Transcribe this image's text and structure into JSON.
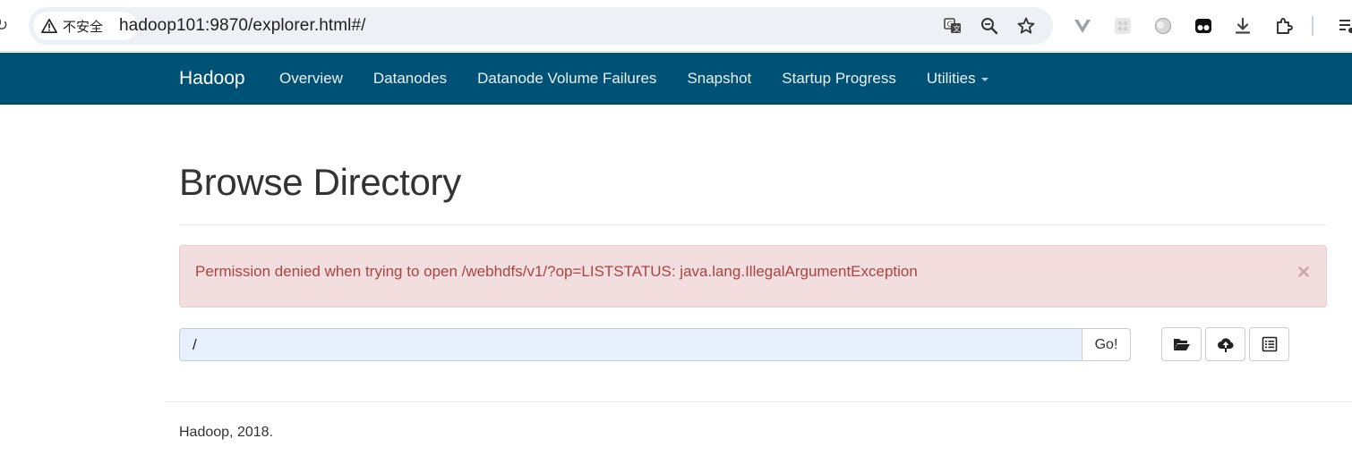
{
  "browser": {
    "security_label": "不安全",
    "url": "hadoop101:9870/explorer.html#/",
    "icons": [
      "translate-icon",
      "zoom-icon",
      "bookmark-star-icon",
      "vue-devtools-icon",
      "extension-grid-icon",
      "extension-blob-icon",
      "extension-mask-icon",
      "download-icon",
      "extensions-puzzle-icon",
      "media-icon"
    ]
  },
  "navbar": {
    "brand": "Hadoop",
    "items": [
      {
        "label": "Overview"
      },
      {
        "label": "Datanodes"
      },
      {
        "label": "Datanode Volume Failures"
      },
      {
        "label": "Snapshot"
      },
      {
        "label": "Startup Progress"
      },
      {
        "label": "Utilities"
      }
    ],
    "background": "#005176"
  },
  "main": {
    "title": "Browse Directory",
    "alert": {
      "message": "Permission denied when trying to open /webhdfs/v1/?op=LISTSTATUS: java.lang.IllegalArgumentException",
      "close": "×"
    },
    "path_value": "/",
    "go_label": "Go!",
    "tools": [
      "folder-open-icon",
      "cloud-upload-icon",
      "list-alt-icon"
    ]
  },
  "footer": {
    "text": "Hadoop, 2018."
  },
  "colors": {
    "alert_bg": "#f2dede",
    "alert_text": "#a94442",
    "input_bg": "#e8f0fe"
  }
}
